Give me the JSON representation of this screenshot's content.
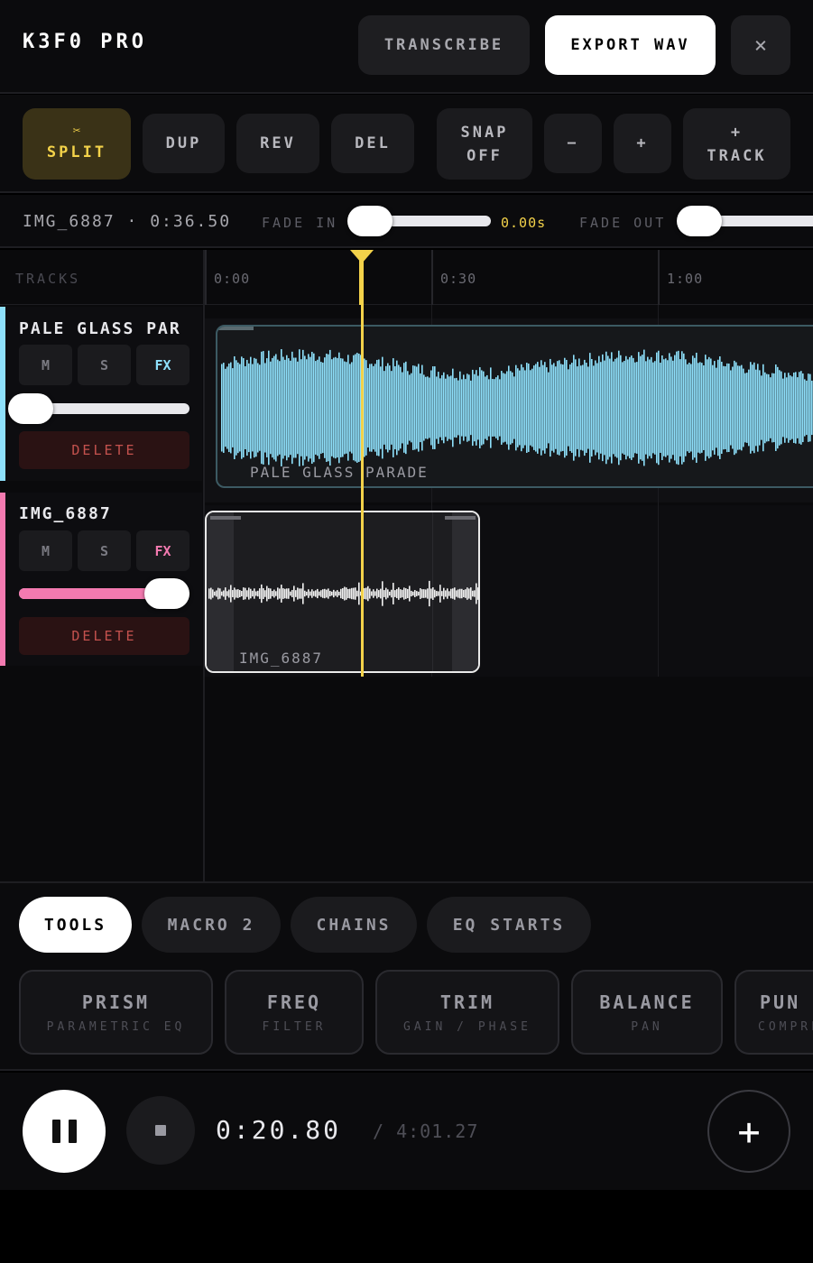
{
  "header": {
    "title": "K3F0 PRO",
    "transcribe_label": "TRANSCRIBE",
    "export_label": "EXPORT WAV",
    "close_label": "×"
  },
  "toolbar": {
    "split_icon": "✂",
    "split_label": "SPLIT",
    "dup_label": "DUP",
    "rev_label": "REV",
    "del_label": "DEL",
    "snap_line1": "SNAP",
    "snap_line2": "OFF",
    "minus_label": "−",
    "plus_label": "+",
    "track_line1": "+",
    "track_line2": "TRACK"
  },
  "fade": {
    "clip_info": "IMG_6887 · 0:36.50",
    "fade_in_label": "FADE IN",
    "fade_in_value_text": "0.00s",
    "fade_out_label": "FADE OUT"
  },
  "timeline": {
    "tracks_label": "TRACKS",
    "ruler": [
      "0:00",
      "0:30",
      "1:00"
    ]
  },
  "tracks": [
    {
      "name": "PALE GLASS PAR",
      "clip_label": "PALE GLASS PARADE",
      "color": "#8ee0fb",
      "mute": "M",
      "solo": "S",
      "fx": "FX",
      "volume": 0.07,
      "delete_label": "DELETE"
    },
    {
      "name": "IMG_6887",
      "clip_label": "IMG_6887",
      "color": "#f37ab0",
      "mute": "M",
      "solo": "S",
      "fx": "FX",
      "volume": 0.87,
      "delete_label": "DELETE"
    }
  ],
  "bottom": {
    "tabs": [
      "TOOLS",
      "MACRO 2",
      "CHAINS",
      "EQ STARTS"
    ],
    "active_tab": "TOOLS",
    "fx": [
      {
        "title": "PRISM",
        "sub": "PARAMETRIC EQ"
      },
      {
        "title": "FREQ",
        "sub": "FILTER"
      },
      {
        "title": "TRIM",
        "sub": "GAIN / PHASE"
      },
      {
        "title": "BALANCE",
        "sub": "PAN"
      },
      {
        "title": "PUN",
        "sub": "COMPRE"
      }
    ]
  },
  "transport": {
    "time_current": "0:20.80",
    "time_total": "/ 4:01.27",
    "add_label": "+"
  },
  "colors": {
    "accent": "#f3d24a",
    "track1": "#8ee0fb",
    "track2": "#f37ab0",
    "delete": "#c4524e"
  }
}
